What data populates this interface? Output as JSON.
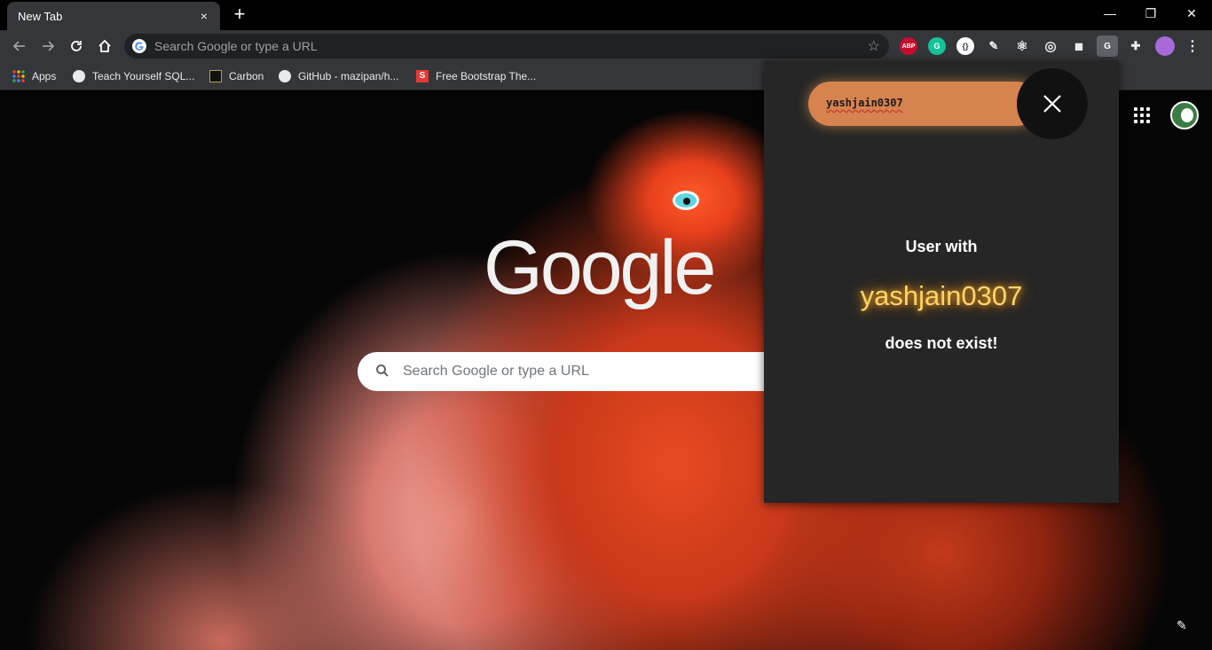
{
  "tab": {
    "title": "New Tab",
    "close_glyph": "×",
    "new_tab_glyph": "+"
  },
  "window_controls": {
    "minimize": "—",
    "restore": "❐",
    "close": "✕"
  },
  "omnibox": {
    "placeholder": "Search Google or type a URL"
  },
  "extensions": [
    {
      "name": "adblock-plus-icon",
      "label": "ABP",
      "color": "#c70d2c"
    },
    {
      "name": "grammarly-icon",
      "label": "G",
      "color": "#15c39a"
    },
    {
      "name": "json-viewer-icon",
      "label": "{}",
      "color": "#5f6368"
    },
    {
      "name": "pen-tool-icon",
      "label": "✎",
      "color": "#35363a"
    },
    {
      "name": "react-devtools-icon",
      "label": "⚛",
      "color": "#35363a"
    },
    {
      "name": "target-icon",
      "label": "◎",
      "color": "#35363a"
    },
    {
      "name": "cube-icon",
      "label": "◼",
      "color": "#35363a"
    },
    {
      "name": "github-user-icon",
      "label": "G",
      "color": "#5f6368"
    },
    {
      "name": "extensions-puzzle-icon",
      "label": "✚",
      "color": "#35363a"
    }
  ],
  "bookmarks": [
    {
      "label": "Apps"
    },
    {
      "label": "Teach Yourself SQL..."
    },
    {
      "label": "Carbon"
    },
    {
      "label": "GitHub - mazipan/h..."
    },
    {
      "label": "Free Bootstrap The..."
    }
  ],
  "ntp": {
    "logo_text": "Google",
    "search_placeholder": "Search Google or type a URL"
  },
  "popup": {
    "search_value": "yashjain0307",
    "message_prefix": "User with",
    "username": "yashjain0307",
    "message_suffix": "does not exist!",
    "accent_color": "#d7834f",
    "glow_color": "#ffd36b"
  }
}
